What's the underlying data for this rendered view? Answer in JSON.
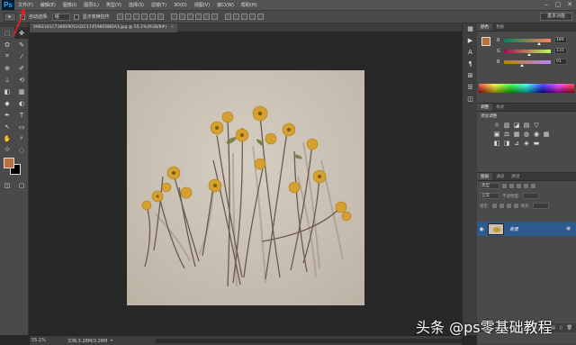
{
  "app": {
    "logo": "Ps"
  },
  "menu": [
    "文件(F)",
    "编辑(E)",
    "图像(I)",
    "图层(L)",
    "类型(Y)",
    "选择(S)",
    "滤镜(T)",
    "3D(D)",
    "视图(V)",
    "窗口(W)",
    "帮助(H)"
  ],
  "window_controls": [
    "‒",
    "▢",
    "✕"
  ],
  "options": {
    "auto_select_label": "自动选择:",
    "auto_select_value": "组",
    "show_transform_label": "显示变换控件",
    "workspace": "基本功能"
  },
  "document": {
    "tab_title": "0983101C7360E905102C1745980DBDA3.jpg @ 55.1%(RGB/8#)",
    "close_glyph": "×"
  },
  "status": {
    "zoom": "55.1%",
    "doc_size": "文档:3.28M/3.28M",
    "arrow": "▸"
  },
  "color_panel": {
    "tabs": [
      "颜色",
      "色板"
    ],
    "fg_color": "#b8703f",
    "bg_color": "#000000",
    "r": 184,
    "g": 131,
    "b": 91,
    "labels": [
      "R",
      "G",
      "B"
    ]
  },
  "adjust_panel": {
    "tabs": [
      "调整",
      "样式"
    ],
    "title": "添加调整",
    "row1": [
      "☼",
      "▥",
      "◪",
      "▤",
      "▽"
    ],
    "row2": [
      "▣",
      "⚖",
      "▦",
      "◍",
      "◉",
      "▦"
    ],
    "row3": [
      "◧",
      "◨",
      "⊿",
      "◈",
      "▬"
    ]
  },
  "layers_panel": {
    "tabs": [
      "图层",
      "通道",
      "路径"
    ],
    "kind_label": "类型",
    "blend_mode": "正常",
    "opacity_label": "不透明度:",
    "lock_label": "锁定:",
    "fill_label": "填充:",
    "layer_name": "背景",
    "eye": "👁",
    "lock_glyph": "🔒",
    "footer_icons": [
      "⊝",
      "fx",
      "◐",
      "▭",
      "▤",
      "▯",
      "🗑"
    ]
  },
  "toolbar": {
    "tools": [
      "▸✥",
      "⬚",
      "ʘ",
      "⌖",
      "⊡",
      "✂",
      "⊕",
      "✎",
      "✐",
      "⊘",
      "⟲",
      "◐",
      "◇",
      "⬮",
      "T",
      "↖",
      "▭",
      "✋",
      "🔍",
      "⬚",
      "◫"
    ]
  },
  "dock_icons": [
    "▦",
    "▶",
    "A",
    "¶",
    "⊞",
    "☰",
    "▦"
  ],
  "watermark": "头条 @ps零基础教程"
}
